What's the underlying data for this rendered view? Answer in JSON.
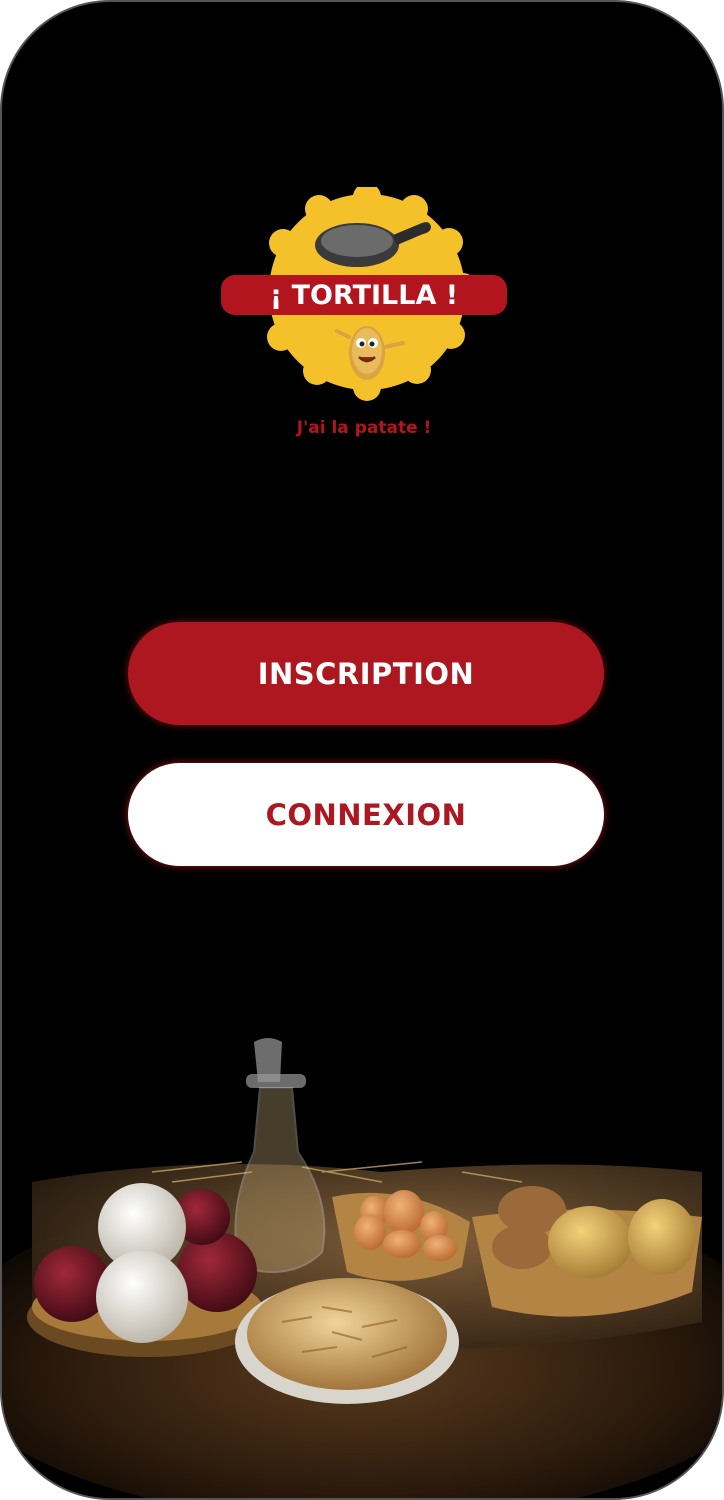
{
  "brand": {
    "logo_text": "¡ TORTILLA !",
    "tagline": "J'ai la patate !"
  },
  "actions": {
    "signup_label": "INSCRIPTION",
    "login_label": "CONNEXION"
  },
  "colors": {
    "brand_red": "#ac1720",
    "logo_yellow": "#f5c12a",
    "background": "#000000",
    "button_text_light": "#ffffff"
  },
  "icons": {
    "logo": "frying-pan-potato-logo",
    "scene": "spanish-tortilla-ingredients-photo"
  }
}
